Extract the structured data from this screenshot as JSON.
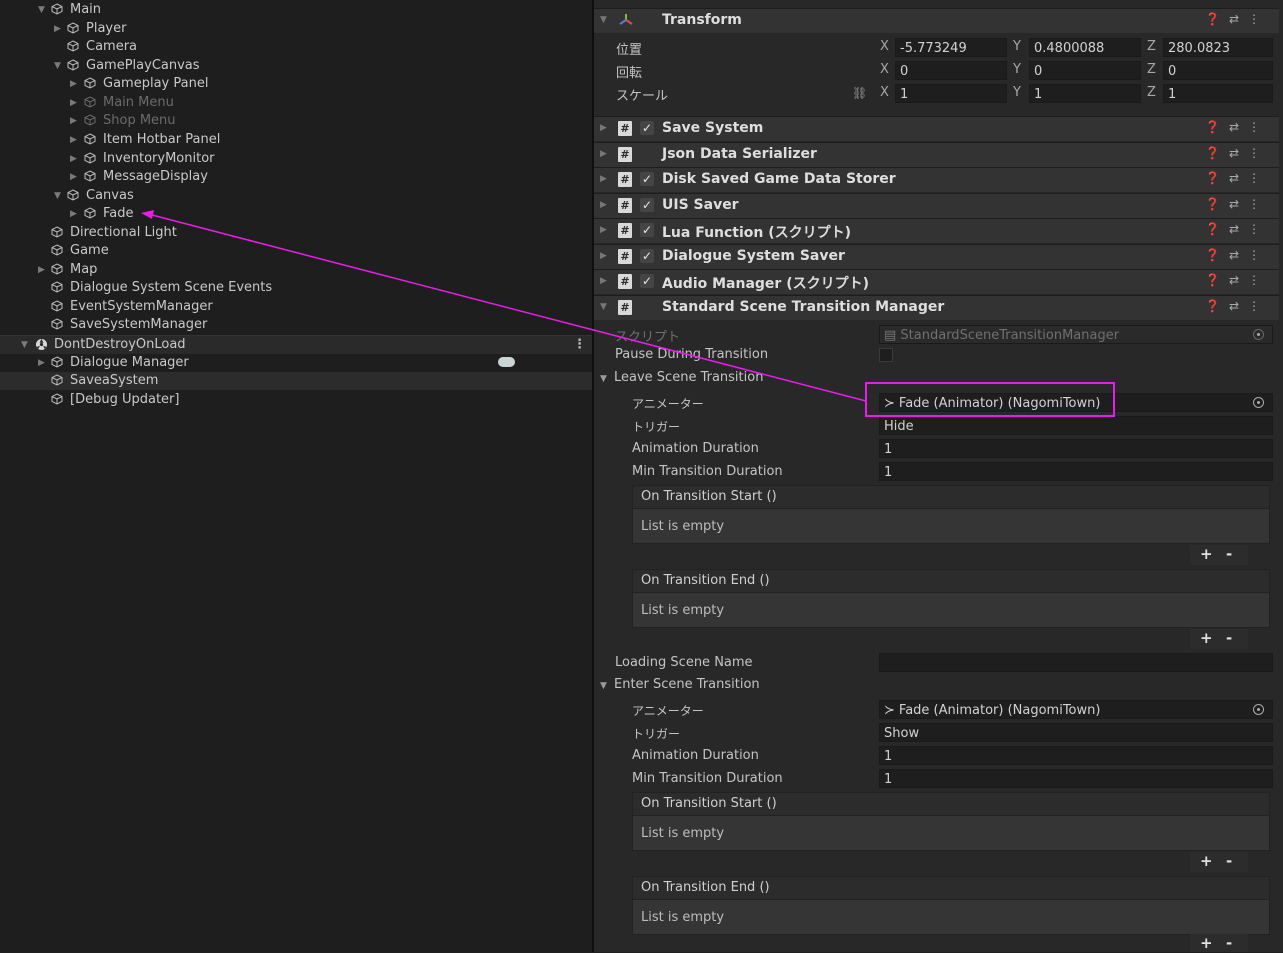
{
  "hierarchy": {
    "items": [
      {
        "label": "Main",
        "icon": "gameobject-cube-icon",
        "expanded": true,
        "dim": false
      },
      {
        "label": "Player",
        "icon": "gameobject-cube-icon",
        "dim": false
      },
      {
        "label": "Camera",
        "icon": "gameobject-cube-icon",
        "dim": false
      },
      {
        "label": "GamePlayCanvas",
        "icon": "gameobject-cube-icon",
        "expanded": true,
        "dim": false
      },
      {
        "label": "Gameplay Panel",
        "icon": "gameobject-cube-icon",
        "dim": false
      },
      {
        "label": "Main Menu",
        "icon": "gameobject-cube-icon",
        "dim": true
      },
      {
        "label": "Shop Menu",
        "icon": "gameobject-cube-icon",
        "dim": true
      },
      {
        "label": "Item Hotbar Panel",
        "icon": "gameobject-cube-icon",
        "dim": false
      },
      {
        "label": "InventoryMonitor",
        "icon": "gameobject-cube-icon",
        "dim": false
      },
      {
        "label": "MessageDisplay",
        "icon": "gameobject-cube-icon",
        "dim": false
      },
      {
        "label": "Canvas",
        "icon": "gameobject-cube-icon",
        "expanded": true,
        "dim": false
      },
      {
        "label": "Fade",
        "icon": "gameobject-cube-icon",
        "dim": false
      },
      {
        "label": "Directional Light",
        "icon": "gameobject-cube-icon",
        "dim": false
      },
      {
        "label": "Game",
        "icon": "gameobject-cube-icon",
        "dim": false
      },
      {
        "label": "Map",
        "icon": "gameobject-cube-icon",
        "dim": false
      },
      {
        "label": "Dialogue System Scene Events",
        "icon": "gameobject-cube-icon",
        "dim": false
      },
      {
        "label": "EventSystemManager",
        "icon": "gameobject-cube-icon",
        "dim": false
      },
      {
        "label": "SaveSystemManager",
        "icon": "gameobject-cube-icon",
        "dim": false
      },
      {
        "label": "DontDestroyOnLoad",
        "icon": "scene-icon",
        "dim": false
      },
      {
        "label": "Dialogue Manager",
        "icon": "gameobject-cube-icon",
        "dim": false
      },
      {
        "label": "SaveaSystem",
        "icon": "gameobject-cube-icon",
        "dim": false
      },
      {
        "label": "[Debug Updater]",
        "icon": "gameobject-cube-icon",
        "dim": false
      }
    ],
    "menu_icon": "more-options-icon"
  },
  "inspector": {
    "transform": {
      "title": "Transform",
      "position_label": "位置",
      "rotation_label": "回転",
      "scale_label": "スケール",
      "axis_x": "X",
      "axis_y": "Y",
      "axis_z": "Z",
      "position": {
        "x": "-5.773249",
        "y": "0.4800088",
        "z": "280.0823"
      },
      "rotation": {
        "x": "0",
        "y": "0",
        "z": "0"
      },
      "scale": {
        "x": "1",
        "y": "1",
        "z": "1"
      }
    },
    "components": [
      {
        "title": "Save System",
        "checked": true
      },
      {
        "title": "Json Data Serializer",
        "checked": false
      },
      {
        "title": "Disk Saved Game Data Storer",
        "checked": true
      },
      {
        "title": "UIS Saver",
        "checked": true
      },
      {
        "title": "Lua Function (スクリプト)",
        "checked": true
      },
      {
        "title": "Dialogue System Saver",
        "checked": true
      },
      {
        "title": "Audio Manager (スクリプト)",
        "checked": true
      },
      {
        "title": "Standard Scene Transition Manager",
        "checked": false
      }
    ],
    "check_mark": "✓",
    "script_glyph": "#",
    "sstm": {
      "script_label": "スクリプト",
      "script_value": "StandardSceneTransitionManager",
      "pause_label": "Pause During Transition",
      "leave": {
        "header": "Leave Scene Transition",
        "animator_label": "アニメーター",
        "animator_value": "Fade (Animator) (NagomiTown)",
        "trigger_label": "トリガー",
        "trigger_value": "Hide",
        "anim_duration_label": "Animation Duration",
        "anim_duration_value": "1",
        "min_duration_label": "Min Transition Duration",
        "min_duration_value": "1",
        "on_start": "On Transition Start ()",
        "on_end": "On Transition End ()",
        "empty": "List is empty"
      },
      "loading_label": "Loading Scene Name",
      "enter": {
        "header": "Enter Scene Transition",
        "animator_label": "アニメーター",
        "animator_value": "Fade (Animator) (NagomiTown)",
        "trigger_label": "トリガー",
        "trigger_value": "Show",
        "anim_duration_label": "Animation Duration",
        "anim_duration_value": "1",
        "min_duration_label": "Min Transition Duration",
        "min_duration_value": "1",
        "on_start": "On Transition Start ()",
        "on_end": "On Transition End ()",
        "empty": "List is empty"
      },
      "plus": "+",
      "minus": "-"
    }
  },
  "annotation": {
    "color": "#e81ee8"
  }
}
